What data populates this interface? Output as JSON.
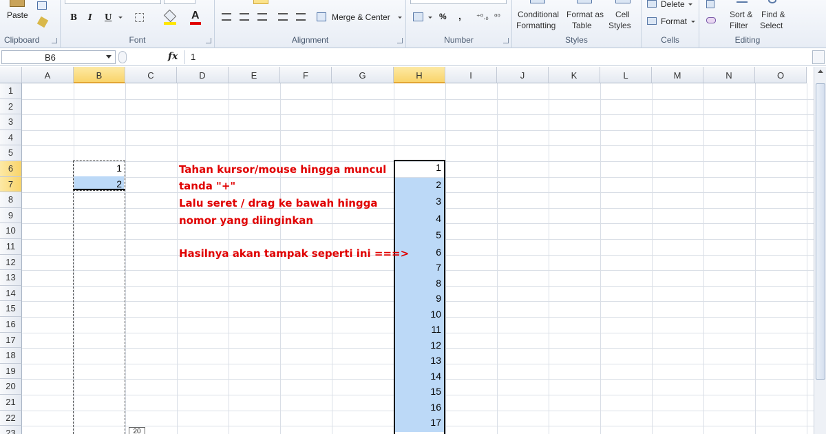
{
  "ribbon": {
    "clipboard": {
      "label": "Clipboard",
      "paste": "Paste"
    },
    "font": {
      "label": "Font",
      "bold": "B",
      "italic": "I",
      "underline": "U",
      "font_color_glyph": "A"
    },
    "alignment": {
      "label": "Alignment",
      "merge_center": "Merge & Center"
    },
    "number": {
      "label": "Number",
      "percent": "%",
      "comma": ",",
      "inc_decimal": "⁺⁰.₀",
      "dec_decimal": "⁰⁰"
    },
    "styles": {
      "label": "Styles",
      "conditional": [
        "Conditional",
        "Formatting"
      ],
      "format_table": [
        "Format as",
        "Table"
      ],
      "cell_styles": [
        "Cell",
        "Styles"
      ]
    },
    "cells": {
      "label": "Cells",
      "delete": "Delete",
      "format": "Format"
    },
    "editing": {
      "label": "Editing",
      "sort": [
        "Sort &",
        "Filter"
      ],
      "find": [
        "Find &",
        "Select"
      ]
    }
  },
  "formula_bar": {
    "name_box": "B6",
    "fx": "fx",
    "value": "1"
  },
  "columns": [
    "A",
    "B",
    "C",
    "D",
    "E",
    "F",
    "G",
    "H",
    "I",
    "J",
    "K",
    "L",
    "M",
    "N",
    "O"
  ],
  "rows": [
    "1",
    "2",
    "3",
    "4",
    "5",
    "6",
    "7",
    "8",
    "9",
    "10",
    "11",
    "12",
    "13",
    "14",
    "15",
    "16",
    "17",
    "18",
    "19",
    "20",
    "21",
    "22",
    "23"
  ],
  "cells": {
    "B6": "1",
    "B7": "2",
    "H": [
      "1",
      "2",
      "3",
      "4",
      "5",
      "6",
      "7",
      "8",
      "9",
      "10",
      "11",
      "12",
      "13",
      "14",
      "15",
      "16",
      "17"
    ],
    "autofill_tooltip": "20"
  },
  "notes": {
    "line1": "Tahan kursor/mouse  hingga muncul",
    "line2": "tanda \"+\"",
    "line3": "Lalu seret / drag ke bawah hingga",
    "line4": "nomor yang diinginkan",
    "line5": "Hasilnya akan tampak seperti ini ===>"
  },
  "colors": {
    "highlight": "#bcd9f7",
    "note": "#e00000",
    "selected_header": "#f9d46a"
  }
}
